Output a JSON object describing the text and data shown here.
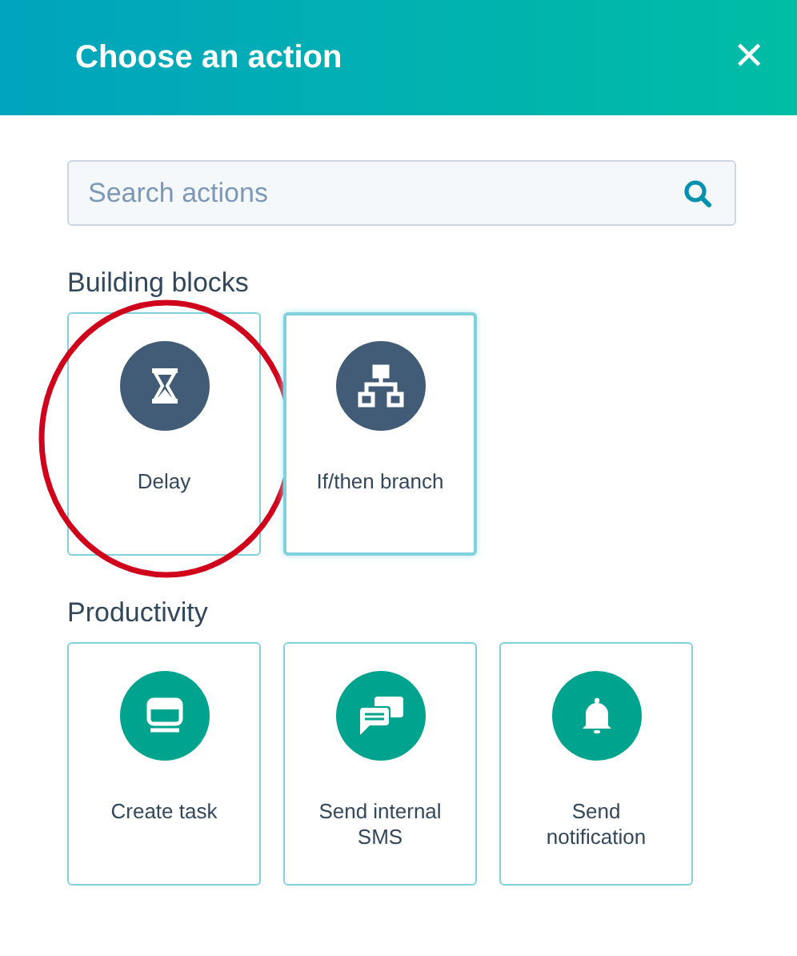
{
  "header": {
    "title": "Choose an action",
    "close": "✕"
  },
  "search": {
    "placeholder": "Search actions"
  },
  "sections": [
    {
      "title": "Building blocks",
      "color": "#425b76",
      "actions": [
        {
          "kind": "delay",
          "label": "Delay",
          "selected": false,
          "circled": true
        },
        {
          "kind": "branch",
          "label": "If/then branch",
          "selected": true,
          "circled": false
        }
      ]
    },
    {
      "title": "Productivity",
      "color": "#00a38d",
      "actions": [
        {
          "kind": "task",
          "label": "Create task",
          "selected": false,
          "circled": false
        },
        {
          "kind": "sms",
          "label": "Send internal SMS",
          "selected": false,
          "circled": false
        },
        {
          "kind": "notification",
          "label": "Send notification",
          "selected": false,
          "circled": false
        }
      ]
    }
  ]
}
